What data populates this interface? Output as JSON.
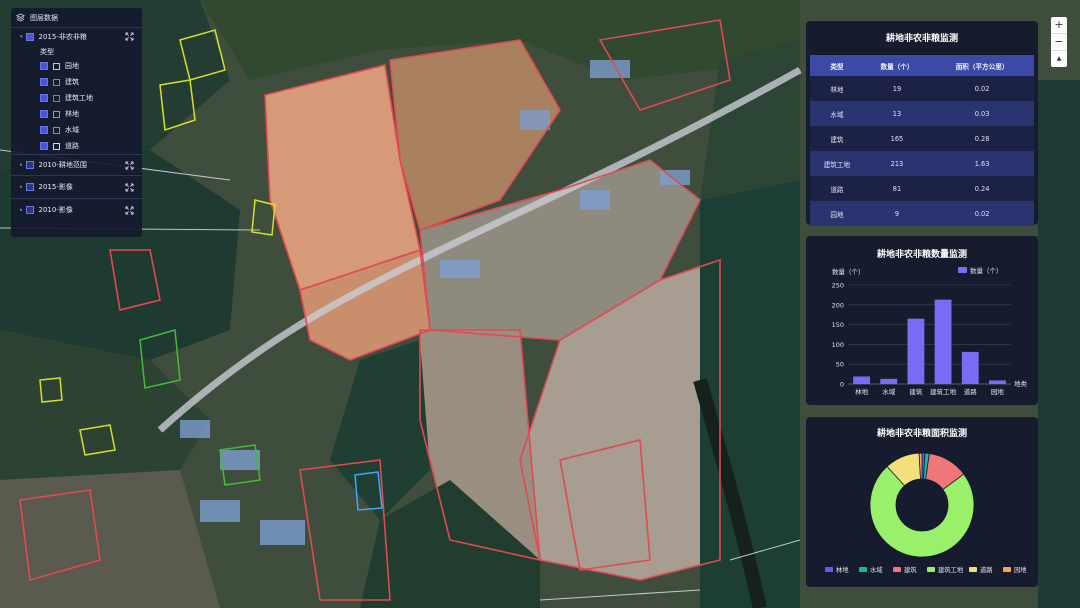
{
  "layer_panel": {
    "title": "图层数据",
    "group1": {
      "label": "2015-非农非粮",
      "sub_label": "类型",
      "types": [
        {
          "label": "园地",
          "color": "#d6e02a"
        },
        {
          "label": "建筑",
          "color": "#44bb3f"
        },
        {
          "label": "建筑工地",
          "color": "#d05a7a"
        },
        {
          "label": "林地",
          "color": "#2ecfa8"
        },
        {
          "label": "水域",
          "color": "#42a5ff"
        },
        {
          "label": "道路",
          "color": "#cfd4e6"
        }
      ]
    },
    "group2": {
      "label": "2010-耕地范围"
    },
    "group3": {
      "label": "2015-影像"
    },
    "group4": {
      "label": "2010-影像"
    }
  },
  "zoom": {
    "in": "+",
    "out": "−",
    "reset": "▲"
  },
  "table_panel": {
    "title": "耕地非农非粮监测",
    "headers": [
      "类型",
      "数量（个）",
      "面积（平方公里）"
    ],
    "rows": [
      [
        "林地",
        "19",
        "0.02"
      ],
      [
        "水域",
        "13",
        "0.03"
      ],
      [
        "建筑",
        "165",
        "0.28"
      ],
      [
        "建筑工地",
        "213",
        "1.63"
      ],
      [
        "道路",
        "81",
        "0.24"
      ],
      [
        "园地",
        "9",
        "0.02"
      ]
    ]
  },
  "chart_data": [
    {
      "type": "bar",
      "title": "耕地非农非粮数量监测",
      "ylabel": "数量（个）",
      "xlabel": "地类",
      "legend": "数量（个）",
      "legend_position": "top-right",
      "categories": [
        "林地",
        "水域",
        "建筑",
        "建筑工地",
        "道路",
        "园地"
      ],
      "values": [
        19,
        13,
        165,
        213,
        81,
        9
      ],
      "yticks": [
        0,
        50,
        100,
        150,
        200,
        250
      ],
      "ylim": [
        0,
        250
      ],
      "bar_color": "#7b6cf6",
      "grid": true
    },
    {
      "type": "pie",
      "title": "耕地非农非粮面积监测",
      "donut": true,
      "labels": [
        "林地",
        "水域",
        "建筑",
        "建筑工地",
        "道路",
        "园地"
      ],
      "values": [
        0.02,
        0.03,
        0.28,
        1.63,
        0.24,
        0.02
      ],
      "colors": [
        "#5b5ff0",
        "#17b89b",
        "#f07777",
        "#9af06a",
        "#f4e07a",
        "#f2a94a"
      ],
      "legend_position": "bottom"
    }
  ]
}
